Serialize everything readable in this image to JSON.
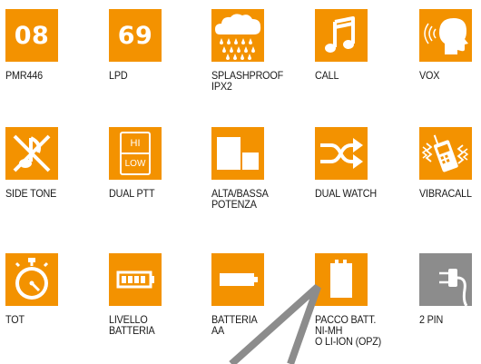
{
  "colors": {
    "tile": "#f39200",
    "tile_alt": "#8c8c8c",
    "text": "#1a1a1a"
  },
  "row1": [
    {
      "number": "08",
      "label": "PMR446"
    },
    {
      "number": "69",
      "label": "LPD"
    },
    {
      "icon": "rain-cloud-icon",
      "label": "SPLASHPROOF",
      "label2": "IPX2"
    },
    {
      "icon": "music-note-icon",
      "label": "CALL"
    },
    {
      "icon": "voice-head-icon",
      "label": "VOX"
    }
  ],
  "row2": [
    {
      "icon": "muted-note-icon",
      "label": "SIDE TONE"
    },
    {
      "icon": "hi-low-icon",
      "hi": "HI",
      "low": "LOW",
      "label": "DUAL PTT"
    },
    {
      "icon": "power-bars-icon",
      "label": "ALTA/BASSA",
      "label2": "POTENZA"
    },
    {
      "icon": "shuffle-arrows-icon",
      "label": "DUAL WATCH"
    },
    {
      "icon": "vibrating-radio-icon",
      "label": "VIBRACALL"
    }
  ],
  "row3": [
    {
      "icon": "stopwatch-icon",
      "label": "TOT"
    },
    {
      "icon": "battery-level-icon",
      "label": "LIVELLO BATTERIA"
    },
    {
      "icon": "aa-battery-icon",
      "label": "BATTERIA",
      "label2": "AA"
    },
    {
      "icon": "battery-pack-icon",
      "label": "PACCO BATT.",
      "label2": "NI-MH",
      "label3": "O LI-ION (OPZ)"
    },
    {
      "icon": "two-pin-plug-icon",
      "label": "2 PIN"
    }
  ]
}
